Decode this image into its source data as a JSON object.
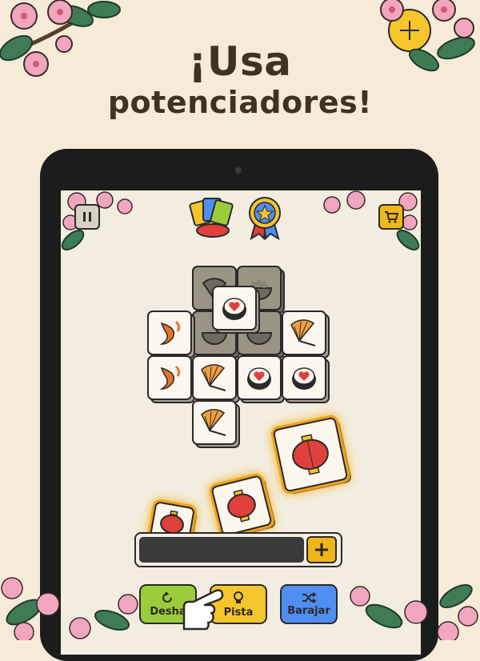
{
  "headline": {
    "line1": "¡Usa",
    "line2": "potenciadores!"
  },
  "top_bar": {
    "pause_icon": "pause-icon",
    "shop_icon": "cart-icon",
    "boosters": [
      "cards-booster-icon",
      "star-medal-icon"
    ]
  },
  "board": {
    "tiles": [
      {
        "icon": "fan",
        "dim": true
      },
      {
        "icon": "rice-bowl",
        "dim": true
      },
      {
        "icon": "sushi-heart"
      },
      {
        "icon": "koi-fish"
      },
      {
        "icon": "rice-bowl",
        "dim": true
      },
      {
        "icon": "rice-bowl",
        "dim": true
      },
      {
        "icon": "fan"
      },
      {
        "icon": "koi-fish"
      },
      {
        "icon": "fan"
      },
      {
        "icon": "sushi-heart"
      },
      {
        "icon": "sushi-heart"
      },
      {
        "icon": "fan"
      }
    ],
    "flying_tiles": [
      "lantern",
      "lantern",
      "lantern"
    ]
  },
  "tray": {
    "add_label": "+"
  },
  "buttons": {
    "undo": {
      "label": "Deshacer",
      "visible_label": "Desha",
      "color": "#9ccc3a"
    },
    "hint": {
      "label": "Pista",
      "color": "#f6c52b"
    },
    "shuffle": {
      "label": "Barajar",
      "color": "#4f8ef2"
    }
  },
  "colors": {
    "background": "#f6ead8",
    "blossom": "#f2a6bd",
    "leaf": "#3f7b55",
    "highlight": "#f0a21b"
  }
}
